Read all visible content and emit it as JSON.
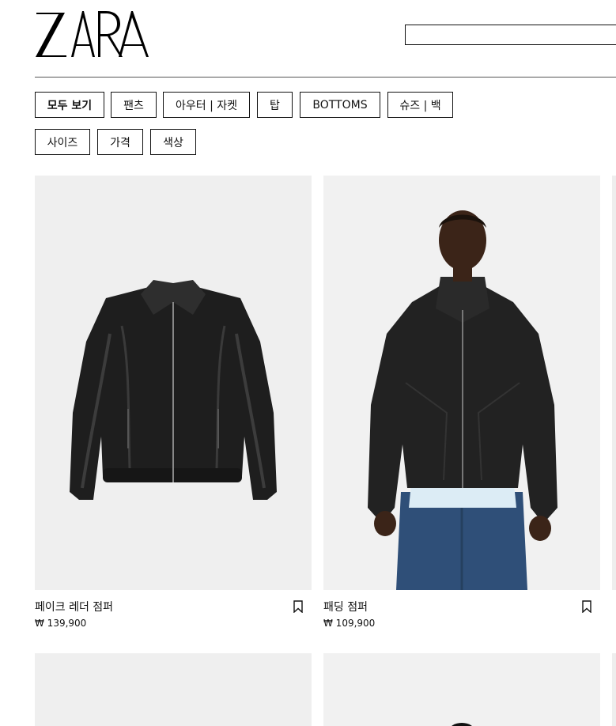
{
  "header": {
    "brand": "ZARA",
    "search": {
      "value": "",
      "placeholder": ""
    }
  },
  "filters": {
    "categories": [
      {
        "label": "모두 보기",
        "active": true
      },
      {
        "label": "팬츠",
        "active": false
      },
      {
        "label": "아우터 | 자켓",
        "active": false
      },
      {
        "label": "탑",
        "active": false
      },
      {
        "label": "BOTTOMS",
        "active": false
      },
      {
        "label": "슈즈 | 백",
        "active": false
      }
    ],
    "options": [
      {
        "label": "사이즈"
      },
      {
        "label": "가격"
      },
      {
        "label": "색상"
      }
    ]
  },
  "products": [
    {
      "name": "페이크 레더 점퍼",
      "price": "₩ 139,900",
      "image": "black faux leather bomber jacket on white background"
    },
    {
      "name": "패딩 점퍼",
      "price": "₩ 109,900",
      "image": "model wearing black padded jacket with jeans"
    }
  ],
  "icons": {
    "bookmark": "bookmark-icon"
  },
  "colors": {
    "background": "#ffffff",
    "text": "#111111",
    "image_bg": "#eeeeee"
  }
}
